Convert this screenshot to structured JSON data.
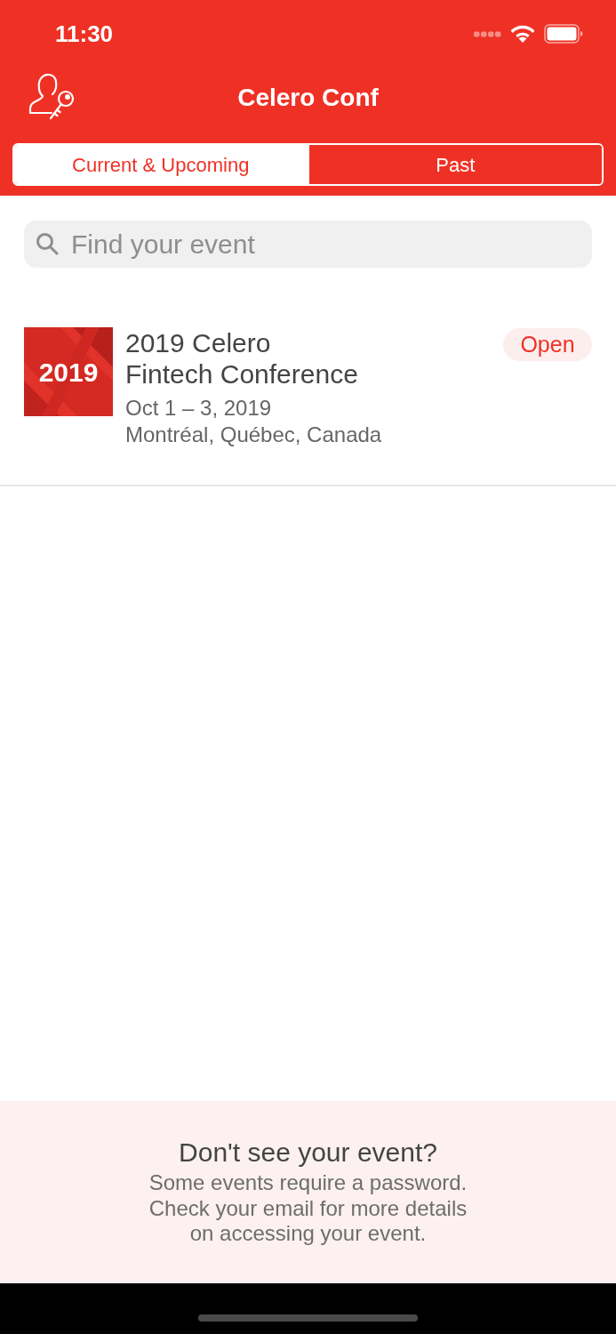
{
  "status_bar": {
    "time": "11:30"
  },
  "nav_bar": {
    "title": "Celero Conf"
  },
  "tabs": [
    {
      "label": "Current & Upcoming",
      "selected": true
    },
    {
      "label": "Past",
      "selected": false
    }
  ],
  "search": {
    "placeholder": "Find your event"
  },
  "events": [
    {
      "thumbnail_text": "2019",
      "title": "2019 Celero\nFintech Conference",
      "dates": "Oct 1 – 3, 2019",
      "location": "Montréal, Québec, Canada",
      "status": "Open"
    }
  ],
  "footer": {
    "heading": "Don't see your event?",
    "message": "Some events require a password.\nCheck your email for more details\non accessing your event."
  }
}
